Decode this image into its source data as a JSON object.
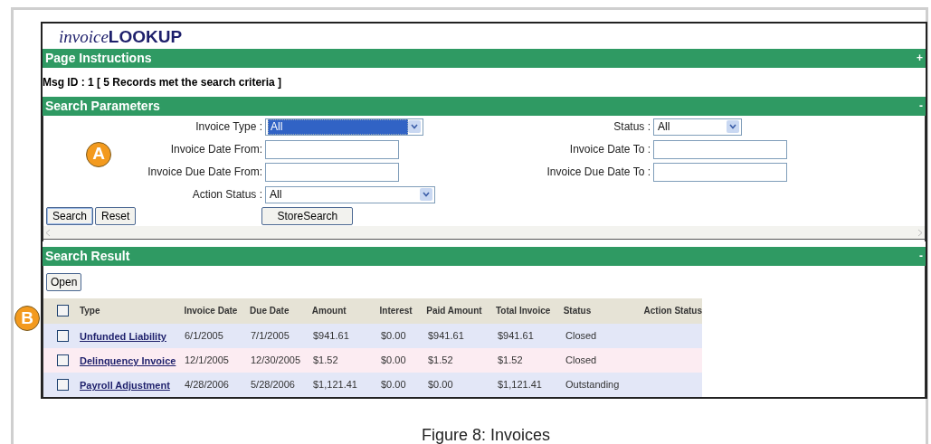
{
  "app": {
    "logo_prefix": "invoice",
    "logo_suffix": "LOOKUP"
  },
  "page_instructions": {
    "title": "Page Instructions",
    "toggle": "+"
  },
  "message": "Msg ID : 1 [ 5 Records met the search criteria ]",
  "search_parameters": {
    "title": "Search Parameters",
    "toggle": "-",
    "left_fields": [
      {
        "kind": "select",
        "label": "Invoice Type :",
        "value": "All",
        "focused": true
      },
      {
        "kind": "input",
        "label": "Invoice Date From:"
      },
      {
        "kind": "input",
        "label": "Invoice Due Date From:"
      },
      {
        "kind": "select",
        "label": "Action Status :",
        "value": "All",
        "focused": false,
        "wide": true
      }
    ],
    "right_fields": [
      {
        "kind": "select",
        "label": "Status :",
        "value": "All",
        "focused": false
      },
      {
        "kind": "input",
        "label": "Invoice Date To :"
      },
      {
        "kind": "input",
        "label": "Invoice Due Date To :"
      }
    ],
    "buttons": [
      "Search",
      "Reset"
    ],
    "store_button": "StoreSearch"
  },
  "callouts": [
    "A",
    "B"
  ],
  "search_result": {
    "title": "Search Result",
    "toggle": "-",
    "open_button": "Open",
    "select_all": {
      "checked": false
    },
    "columns": [
      "Type",
      "Invoice Date",
      "Due Date",
      "Amount",
      "Interest",
      "Paid Amount",
      "Total Invoice",
      "Status",
      "Action Status"
    ],
    "rows": [
      {
        "checked": false,
        "cells": [
          "Unfunded Liability",
          "6/1/2005",
          "7/1/2005",
          "$941.61",
          "$0.00",
          "$941.61",
          "$941.61",
          "Closed"
        ]
      },
      {
        "checked": false,
        "cells": [
          "Delinquency Invoice",
          "12/1/2005",
          "12/30/2005",
          "$1.52",
          "$0.00",
          "$1.52",
          "$1.52",
          "Closed"
        ]
      },
      {
        "checked": false,
        "cells": [
          "Payroll Adjustment",
          "4/28/2006",
          "5/28/2006",
          "$1,121.41",
          "$0.00",
          "$0.00",
          "$1,121.41",
          "Outstanding"
        ]
      }
    ]
  },
  "caption": "Figure 8: Invoices"
}
